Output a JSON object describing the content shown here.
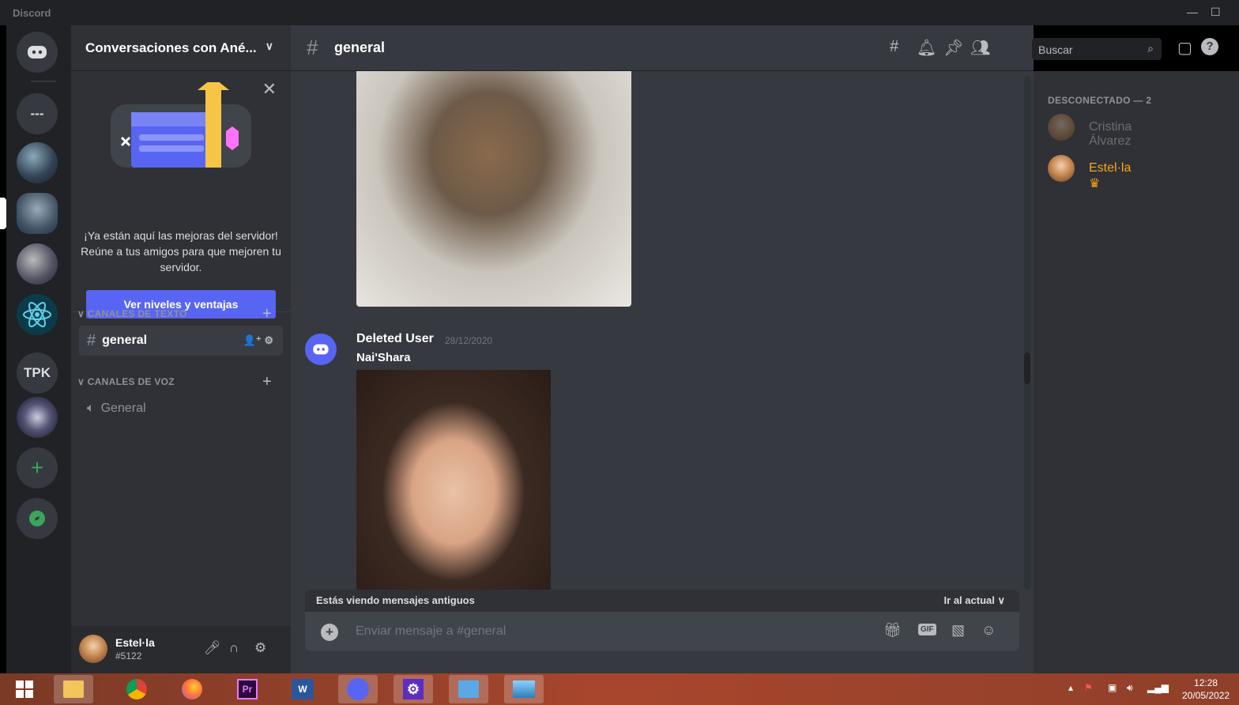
{
  "window": {
    "app_name": "Discord",
    "minimize_icon": "—",
    "maximize_icon": "☐"
  },
  "guilds": [
    {
      "label": "---"
    },
    {
      "label": "TPK"
    }
  ],
  "server": {
    "name": "Conversaciones con Ané...",
    "boost_message": "¡Ya están aquí las mejoras del servidor! Reúne a tus amigos para que mejoren tu servidor.",
    "boost_button": "Ver niveles y ventajas",
    "text_category": "CANALES DE TEXTO",
    "voice_category": "CANALES DE VOZ",
    "text_channels": [
      {
        "name": "general"
      }
    ],
    "voice_channels": [
      {
        "name": "General"
      }
    ]
  },
  "user": {
    "name": "Estel·la",
    "tag": "#5122"
  },
  "chat": {
    "channel": "general",
    "search_placeholder": "Buscar",
    "message": {
      "author": "Deleted User",
      "timestamp": "28/12/2020",
      "text": "Nai'Shara"
    },
    "old_messages_notice": "Estás viendo mensajes antiguos",
    "jump_present": "Ir al actual",
    "composer_placeholder": "Enviar mensaje a #general",
    "gif_label": "GIF"
  },
  "members": {
    "section": "DESCONECTADO — 2",
    "list": [
      {
        "name": "Cristina Álvarez"
      },
      {
        "name": "Estel·la"
      }
    ]
  },
  "taskbar": {
    "apps": [
      "file-explorer",
      "chrome",
      "firefox",
      "premiere-pro",
      "word",
      "discord",
      "settings",
      "control-panel",
      "photos"
    ],
    "premiere_label": "Pr",
    "word_label": "W",
    "time": "12:28",
    "date": "20/05/2022"
  },
  "colors": {
    "accent": "#5865f2",
    "owner_crown": "#faa61a",
    "online_green": "#3ba55d"
  }
}
